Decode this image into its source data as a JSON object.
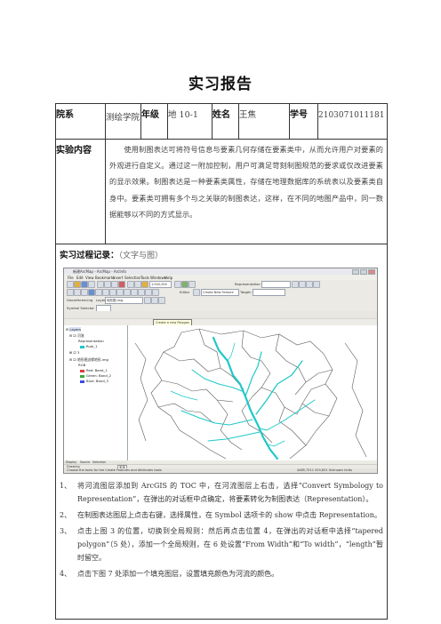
{
  "doc": {
    "title": "实习报告"
  },
  "info": {
    "dept_label": "院系",
    "dept_value": "测绘学院",
    "grade_label": "年级",
    "grade_value": "地 10-1",
    "name_label": "姓名",
    "name_value": "王焦",
    "id_label": "学号",
    "id_value": "2103071011181"
  },
  "content": {
    "label": "实验内容",
    "text": "使用制图表达可将符号信息与要素几何存储在要素类中，从而允许用户对要素的外观进行自定义。通过这一附加控制，用户可满足苛刻制图规范的要求或仅改进要素的显示效果。制图表达是一种要素类属性，存储在地理数据库的系统表以及要素类自身中。要素类可拥有多个与之关联的制图表达，这样，在不同的地图产品中，同一数据能够以不同的方式显示。"
  },
  "process": {
    "label": "实习过程记录",
    "note": "（文字与图）"
  },
  "screenshot": {
    "window_title": "新建ArcMap - ArcMap - ArcInfo",
    "menus": [
      "File",
      "Edit",
      "View",
      "Bookmarks",
      "Insert",
      "Selection",
      "Tools",
      "Windows",
      "Help"
    ],
    "scale": "1:500,000",
    "representation_label": "Representation",
    "editor_label": "Editor",
    "create_label": "Create New Feature",
    "target_label": "Target:",
    "georef_label": "Georeferencing",
    "layer_label": "Layer:",
    "layer_value": "地形图.img",
    "symbol_label": "Symbol Selector",
    "tooltip": "Create a new Polygon",
    "toc": {
      "layers_root": "Layers",
      "rivers": "河流",
      "representation": "Representation",
      "rule": "Rule_1",
      "node3": "3",
      "raster": "地形图边缘地形.img",
      "rgb": "RGB",
      "red": "Red:  Band_1",
      "green": "Green: Band_2",
      "blue": "Blue:  Band_3"
    },
    "tabs": [
      "Display",
      "Source",
      "Selection"
    ],
    "drawing_label": "Drawing",
    "font_label": "宋体",
    "status_left": "Choose the tools for the Create Features and Attributes tools",
    "status_right": "4485,7511 529,631 Unknown Units",
    "colors": {
      "river": "#1ec8c8",
      "boundary": "#5a5a5a",
      "red": "#e03a3a",
      "green": "#3aa83a",
      "blue": "#3a4ae0"
    }
  },
  "steps": [
    {
      "num": "1、",
      "text": "将河流图层添加到 ArcGIS 的 TOC 中，在河流图层上右击，选择“Convert Symbology to Representation”，在弹出的对话框中点确定，将要素转化为制图表达（Representation）。"
    },
    {
      "num": "2、",
      "text": "在制图表达图层上点击右键，选择属性，在 Symbol 选项卡的 show 中点击 Representation。"
    },
    {
      "num": "3、",
      "text": "点击上图 3 的位置，切换到全局规则：然后再点击位置 4，在弹出的对话框中选择“tapered polygon”（5 处），添加一个全局规则，在 6 处设置“From Width”和“To width”，“length”暂时留空。"
    },
    {
      "num": "4、",
      "text": "点击下图 7 处添加一个填充图层，设置填充颜色为河流的颜色。"
    }
  ]
}
